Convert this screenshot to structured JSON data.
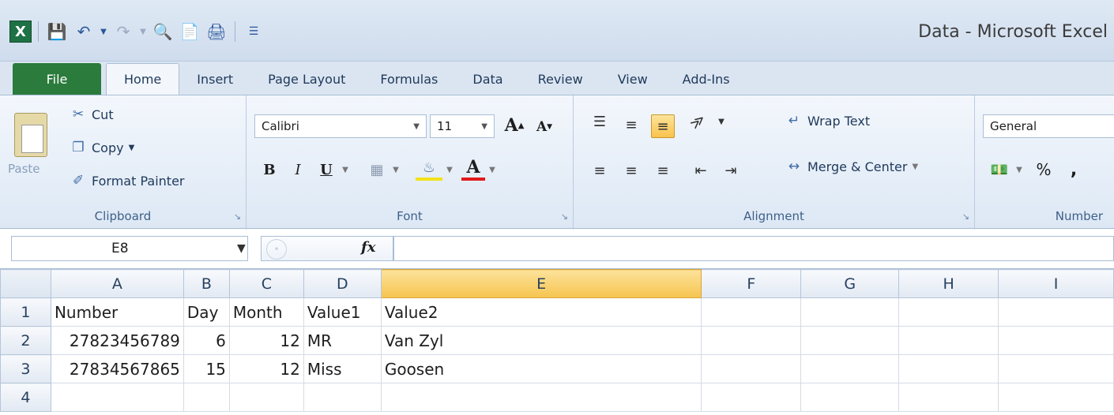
{
  "window": {
    "title": "Data  -  Microsoft Excel"
  },
  "qat": {
    "icons": [
      "excel-icon",
      "save-icon",
      "undo-icon",
      "redo-icon",
      "print-preview-icon",
      "quick-print-icon",
      "print-icon",
      "customize-icon"
    ]
  },
  "tabs": [
    {
      "label": "File"
    },
    {
      "label": "Home"
    },
    {
      "label": "Insert"
    },
    {
      "label": "Page Layout"
    },
    {
      "label": "Formulas"
    },
    {
      "label": "Data"
    },
    {
      "label": "Review"
    },
    {
      "label": "View"
    },
    {
      "label": "Add-Ins"
    }
  ],
  "clipboard": {
    "paste": "Paste",
    "cut": "Cut",
    "copy": "Copy",
    "format_painter": "Format Painter",
    "label": "Clipboard"
  },
  "font": {
    "name": "Calibri",
    "size": "11",
    "bold": "B",
    "italic": "I",
    "underline": "U",
    "label": "Font",
    "grow": "A",
    "shrink": "A",
    "font_color": "A"
  },
  "alignment": {
    "wrap_text": "Wrap Text",
    "merge_center": "Merge & Center",
    "label": "Alignment"
  },
  "number": {
    "format": "General",
    "percent": "%",
    "comma": ",",
    "label": "Number"
  },
  "formula_bar": {
    "name_box": "E8",
    "fx": "fx",
    "formula": ""
  },
  "grid": {
    "columns": [
      "A",
      "B",
      "C",
      "D",
      "E",
      "F",
      "G",
      "H",
      "I"
    ],
    "selected_column": "E",
    "rows": [
      {
        "num": "1",
        "cells": [
          "Number",
          "Day",
          "Month",
          "Value1",
          "Value2",
          "",
          "",
          "",
          ""
        ]
      },
      {
        "num": "2",
        "cells": [
          "27823456789",
          "6",
          "12",
          "MR",
          "Van Zyl",
          "",
          "",
          "",
          ""
        ]
      },
      {
        "num": "3",
        "cells": [
          "27834567865",
          "15",
          "12",
          "Miss",
          "Goosen",
          "",
          "",
          "",
          ""
        ]
      },
      {
        "num": "4",
        "cells": [
          "",
          "",
          "",
          "",
          "",
          "",
          "",
          "",
          ""
        ]
      }
    ]
  }
}
